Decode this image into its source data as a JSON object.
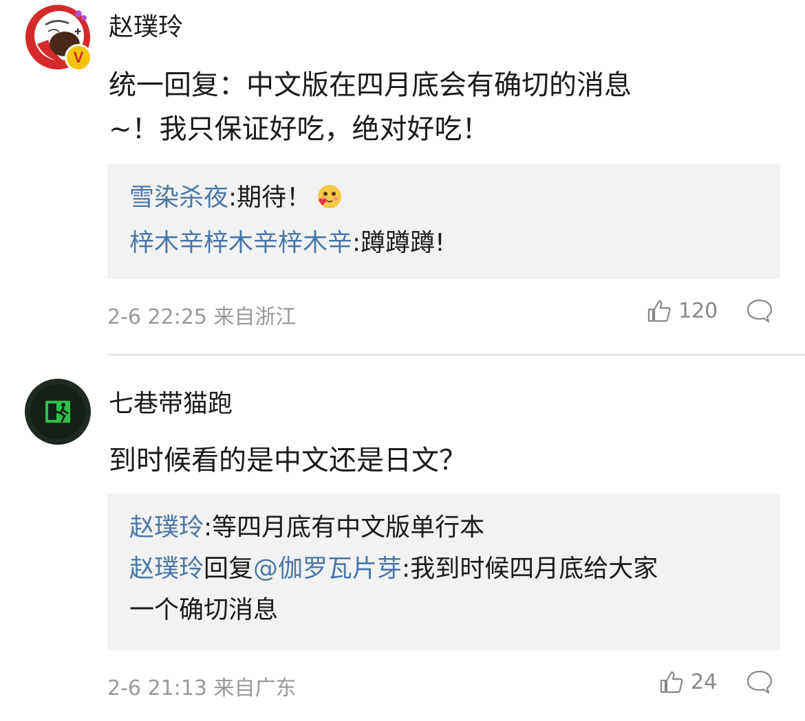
{
  "comments": [
    {
      "user": "赵璞玲",
      "verified": true,
      "text_line1": "统一回复：中文版在四月底会有确切的消息",
      "text_line2": "~！我只保证好吃，绝对好吃！",
      "replies": [
        {
          "name": "雪染杀夜",
          "sep": ":",
          "text": "期待！",
          "emoji": "smiling-hearts-emoji"
        },
        {
          "name": "梓木辛梓木辛梓木辛",
          "sep": ":",
          "text": "蹲蹲蹲!"
        }
      ],
      "meta": "2-6 22:25 来自浙江",
      "likes": "120"
    },
    {
      "user": "七巷带猫跑",
      "verified": false,
      "text_line1": "到时候看的是中文还是日文？",
      "replies": [
        {
          "name": "赵璞玲",
          "sep": ":",
          "text": "等四月底有中文版单行本"
        },
        {
          "name": "赵璞玲",
          "mid": "回复",
          "mention": "@伽罗瓦片芽",
          "sep": ":",
          "text": "我到时候四月底给大家",
          "text2": "一个确切消息"
        }
      ],
      "meta": "2-6 21:13 来自广东",
      "likes": "24"
    }
  ],
  "colors": {
    "link": "#4a77a8",
    "meta": "#999999",
    "reply_bg": "#f2f2f2"
  },
  "icons": [
    "thumbs-up-icon",
    "comment-bubble-icon",
    "verified-v-icon",
    "exit-sign-icon"
  ]
}
